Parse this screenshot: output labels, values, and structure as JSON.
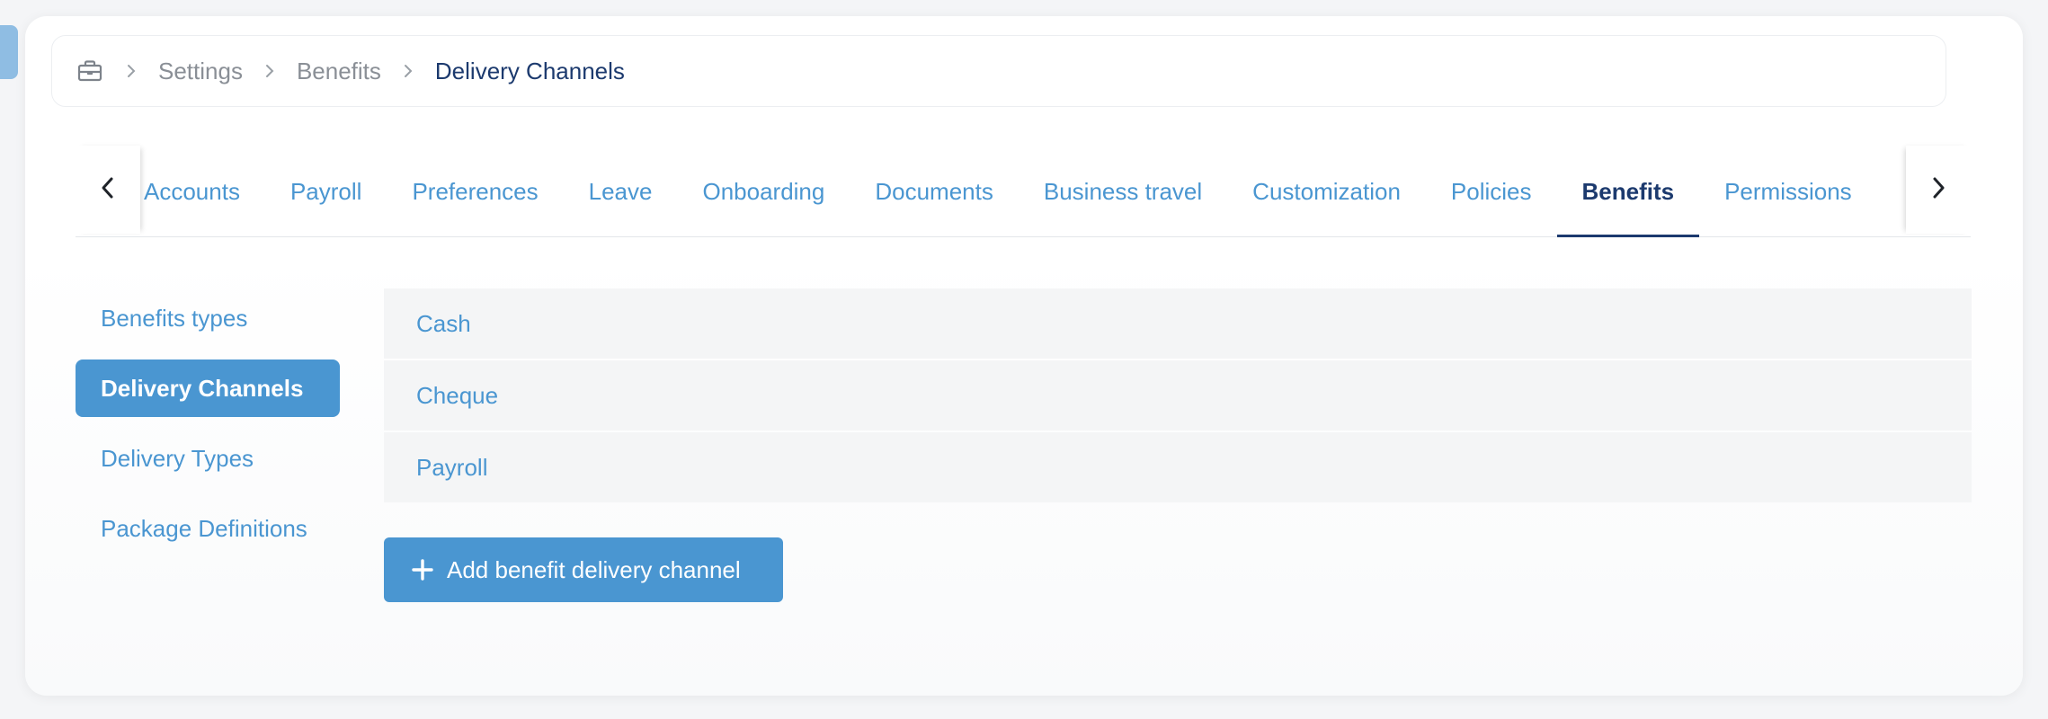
{
  "breadcrumb": {
    "icon": "briefcase-icon",
    "items": [
      "Settings",
      "Benefits"
    ],
    "current": "Delivery Channels"
  },
  "tabs": {
    "prev_icon": "chevron-left-icon",
    "next_icon": "chevron-right-icon",
    "items": [
      {
        "label": "Accounts",
        "active": false
      },
      {
        "label": "Payroll",
        "active": false
      },
      {
        "label": "Preferences",
        "active": false
      },
      {
        "label": "Leave",
        "active": false
      },
      {
        "label": "Onboarding",
        "active": false
      },
      {
        "label": "Documents",
        "active": false
      },
      {
        "label": "Business travel",
        "active": false
      },
      {
        "label": "Customization",
        "active": false
      },
      {
        "label": "Policies",
        "active": false
      },
      {
        "label": "Benefits",
        "active": true
      },
      {
        "label": "Permissions",
        "active": false
      }
    ]
  },
  "sidenav": {
    "items": [
      {
        "label": "Benefits types",
        "active": false
      },
      {
        "label": "Delivery Channels",
        "active": true
      },
      {
        "label": "Delivery Types",
        "active": false
      },
      {
        "label": "Package Definitions",
        "active": false
      }
    ]
  },
  "channels": {
    "rows": [
      "Cash",
      "Cheque",
      "Payroll"
    ]
  },
  "actions": {
    "add_label": "Add benefit delivery channel",
    "add_icon": "plus-icon"
  },
  "colors": {
    "accent": "#4a96d1",
    "navy": "#1c3a6e",
    "muted": "#8a8f96"
  }
}
